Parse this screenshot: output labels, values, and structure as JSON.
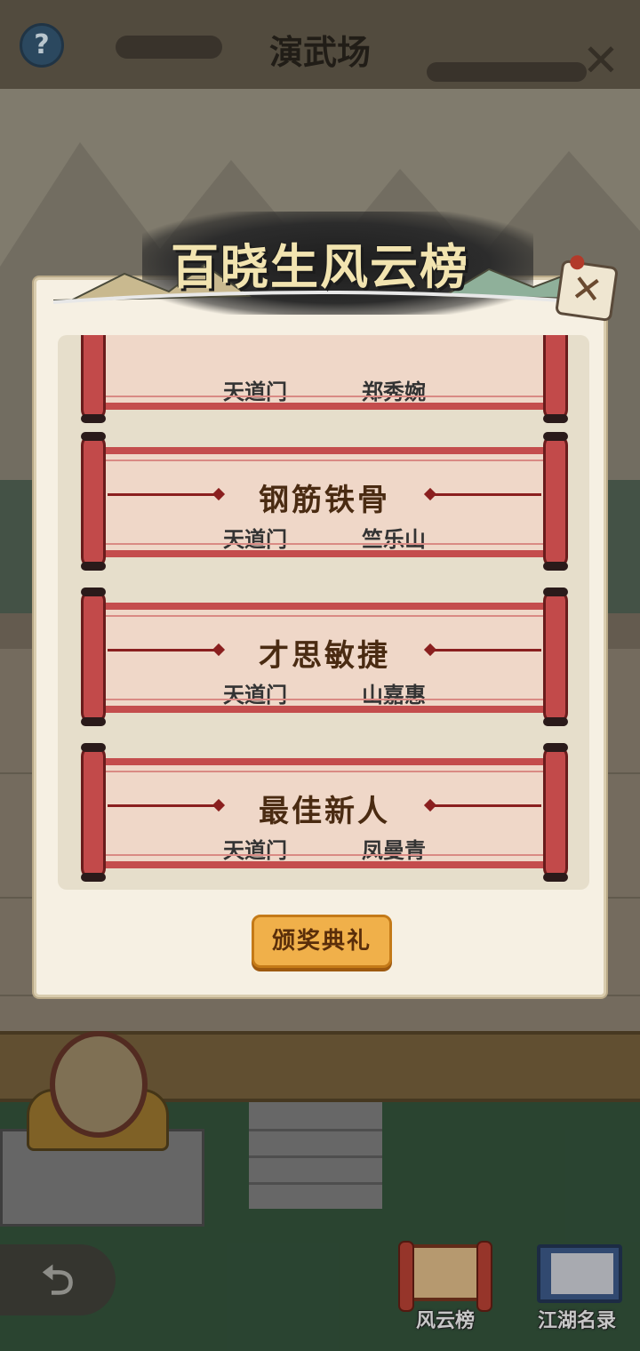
{
  "topbar": {
    "title": "演武场",
    "help_label": "?",
    "close_label": "✕"
  },
  "modal": {
    "banner_title": "百晓生风云榜",
    "close_label": "✕",
    "awards": [
      {
        "title": "",
        "sect": "天道门",
        "winner": "郑秀婉"
      },
      {
        "title": "钢筋铁骨",
        "sect": "天道门",
        "winner": "竺乐山"
      },
      {
        "title": "才思敏捷",
        "sect": "天道门",
        "winner": "山嘉惠"
      },
      {
        "title": "最佳新人",
        "sect": "天道门",
        "winner": "凤曼青"
      }
    ],
    "ceremony_button": "颁奖典礼"
  },
  "bottom_nav": {
    "back_label": "⮌",
    "items": [
      {
        "label": "风云榜",
        "icon": "scroll-icon"
      },
      {
        "label": "江湖名录",
        "icon": "book-icon"
      }
    ]
  },
  "colors": {
    "scroll_red": "#c44d4d",
    "paper": "#efd7c8",
    "button_orange": "#f0b04a",
    "modal_bg": "#f6f0e3"
  }
}
